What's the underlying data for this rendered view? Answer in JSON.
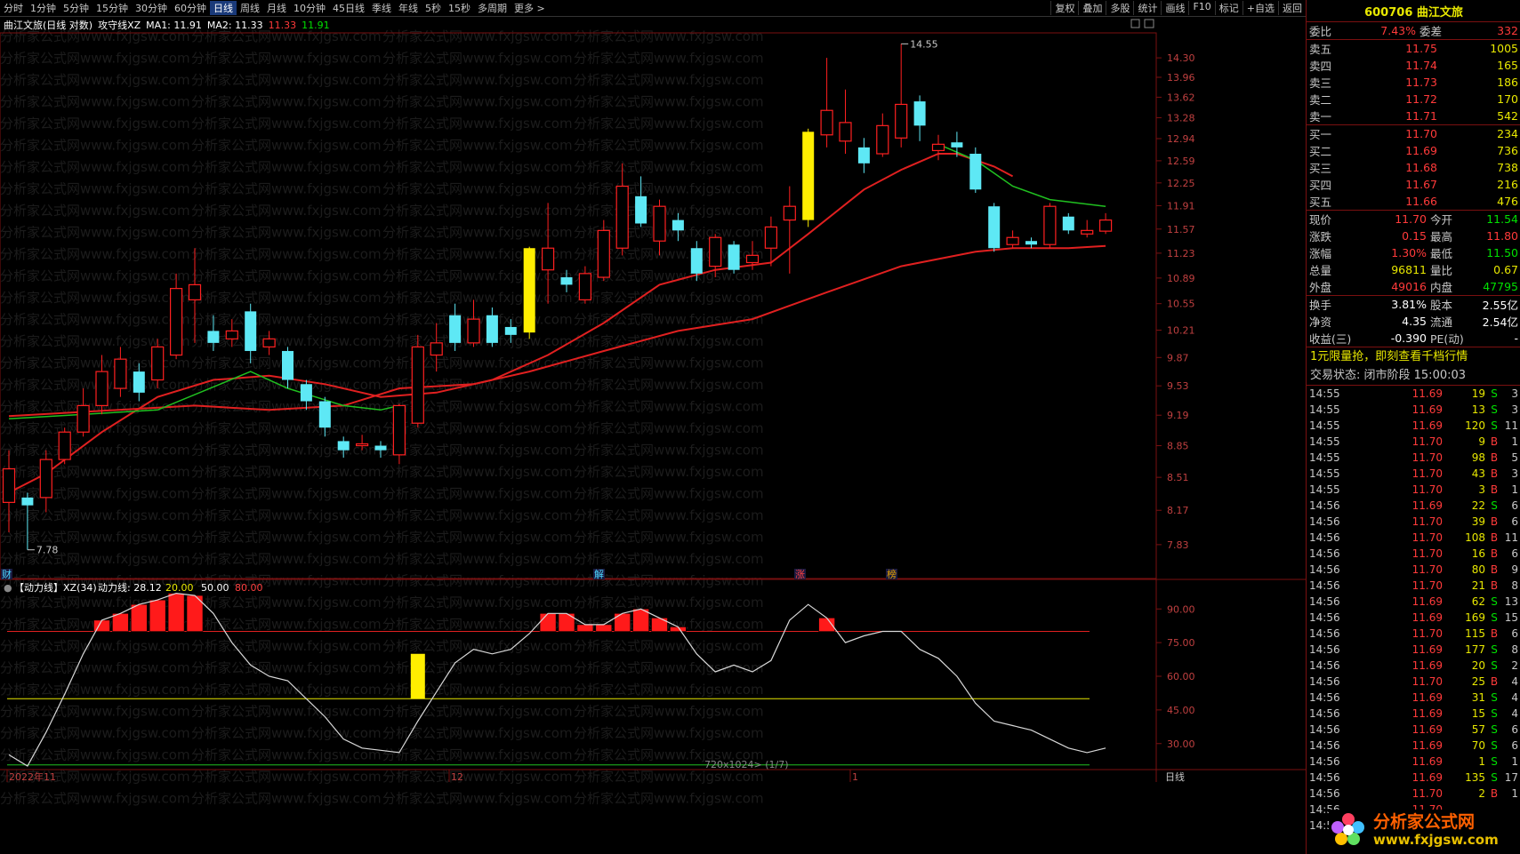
{
  "topbar": {
    "period_tabs": [
      "分时",
      "1分钟",
      "5分钟",
      "15分钟",
      "30分钟",
      "60分钟",
      "日线",
      "周线",
      "月线",
      "10分钟",
      "45日线",
      "季线",
      "年线",
      "5秒",
      "15秒",
      "多周期",
      "更多 >"
    ],
    "active_tab": "日线",
    "tools": [
      "复权",
      "叠加",
      "多股",
      "统计",
      "画线",
      "F10",
      "标记",
      "+自选",
      "返回"
    ]
  },
  "infoline": {
    "stock": "曲江文旅(日线 对数)",
    "indicator": "攻守线XZ",
    "ma1_label": "MA1: 11.91",
    "ma2_label": "MA2: 11.33",
    "v1": "11.33",
    "v2": "11.91"
  },
  "price_axis": [
    "14.30",
    "13.96",
    "13.62",
    "13.28",
    "12.94",
    "12.59",
    "12.25",
    "11.91",
    "11.57",
    "11.23",
    "10.89",
    "10.55",
    "10.21",
    "9.87",
    "9.53",
    "9.19",
    "8.85",
    "8.51",
    "8.17",
    "7.83"
  ],
  "high_label": "14.55",
  "low_label": "7.78",
  "event_marks": [
    "财",
    "解",
    "涨",
    "榜"
  ],
  "sub": {
    "title": "【动力线】XZ(34)",
    "line_label": "动力线: 28.12",
    "v20": "20.00",
    "v50": "50.00",
    "v80": "80.00",
    "axis": [
      "90.00",
      "75.00",
      "60.00",
      "45.00",
      "30.00"
    ]
  },
  "date_axis": [
    "2022年11",
    "12",
    "1"
  ],
  "date_axis_right": "日线",
  "footer_info": "720x1024> (1/7)",
  "watermark": "分析家公式网www.fxjgsw.com",
  "chart_data": {
    "type": "candlestick",
    "title": "曲江文旅(日线 对数)",
    "ylim": [
      7.78,
      14.55
    ],
    "candles": [
      {
        "o": 8.25,
        "c": 8.6,
        "h": 8.8,
        "l": 7.95
      },
      {
        "o": 8.3,
        "c": 8.22,
        "h": 8.35,
        "l": 7.78
      },
      {
        "o": 8.3,
        "c": 8.7,
        "h": 8.8,
        "l": 8.15
      },
      {
        "o": 8.7,
        "c": 9.0,
        "h": 9.05,
        "l": 8.65
      },
      {
        "o": 9.0,
        "c": 9.3,
        "h": 9.5,
        "l": 8.95
      },
      {
        "o": 9.3,
        "c": 9.7,
        "h": 9.9,
        "l": 9.2
      },
      {
        "o": 9.5,
        "c": 9.85,
        "h": 10.0,
        "l": 9.4
      },
      {
        "o": 9.7,
        "c": 9.45,
        "h": 9.8,
        "l": 9.35
      },
      {
        "o": 9.6,
        "c": 10.0,
        "h": 10.1,
        "l": 9.5
      },
      {
        "o": 9.9,
        "c": 10.75,
        "h": 10.95,
        "l": 9.85
      },
      {
        "o": 10.6,
        "c": 10.8,
        "h": 11.3,
        "l": 10.05
      },
      {
        "o": 10.2,
        "c": 10.05,
        "h": 10.4,
        "l": 9.95
      },
      {
        "o": 10.1,
        "c": 10.2,
        "h": 10.35,
        "l": 10.0
      },
      {
        "o": 10.45,
        "c": 9.95,
        "h": 10.55,
        "l": 9.8
      },
      {
        "o": 10.0,
        "c": 10.1,
        "h": 10.2,
        "l": 9.9
      },
      {
        "o": 9.95,
        "c": 9.6,
        "h": 10.0,
        "l": 9.5
      },
      {
        "o": 9.55,
        "c": 9.35,
        "h": 9.6,
        "l": 9.25
      },
      {
        "o": 9.35,
        "c": 9.05,
        "h": 9.4,
        "l": 8.95
      },
      {
        "o": 8.9,
        "c": 8.8,
        "h": 8.95,
        "l": 8.72
      },
      {
        "o": 8.85,
        "c": 8.87,
        "h": 8.97,
        "l": 8.8
      },
      {
        "o": 8.85,
        "c": 8.8,
        "h": 8.9,
        "l": 8.72
      },
      {
        "o": 8.75,
        "c": 9.3,
        "h": 9.32,
        "l": 8.65
      },
      {
        "o": 9.1,
        "c": 10.0,
        "h": 10.15,
        "l": 9.05
      },
      {
        "o": 9.9,
        "c": 10.05,
        "h": 10.3,
        "l": 9.7
      },
      {
        "o": 10.4,
        "c": 10.05,
        "h": 10.55,
        "l": 9.95
      },
      {
        "o": 10.05,
        "c": 10.35,
        "h": 10.6,
        "l": 10.0
      },
      {
        "o": 10.4,
        "c": 10.05,
        "h": 10.5,
        "l": 10.0
      },
      {
        "o": 10.25,
        "c": 10.15,
        "h": 10.35,
        "l": 10.05
      },
      {
        "o": 10.18,
        "c": 11.3,
        "h": 11.32,
        "l": 10.1
      },
      {
        "o": 11.0,
        "c": 11.3,
        "h": 11.95,
        "l": 10.55
      },
      {
        "o": 10.9,
        "c": 10.8,
        "h": 11.0,
        "l": 10.7
      },
      {
        "o": 10.6,
        "c": 10.95,
        "h": 11.05,
        "l": 10.55
      },
      {
        "o": 10.9,
        "c": 11.55,
        "h": 11.7,
        "l": 10.85
      },
      {
        "o": 11.3,
        "c": 12.2,
        "h": 12.55,
        "l": 11.2
      },
      {
        "o": 12.05,
        "c": 11.65,
        "h": 12.35,
        "l": 11.6
      },
      {
        "o": 11.4,
        "c": 11.9,
        "h": 12.0,
        "l": 11.2
      },
      {
        "o": 11.7,
        "c": 11.55,
        "h": 11.8,
        "l": 11.4
      },
      {
        "o": 11.3,
        "c": 10.95,
        "h": 11.4,
        "l": 10.85
      },
      {
        "o": 11.05,
        "c": 11.45,
        "h": 11.5,
        "l": 10.9
      },
      {
        "o": 11.35,
        "c": 11.0,
        "h": 11.4,
        "l": 10.95
      },
      {
        "o": 11.1,
        "c": 11.2,
        "h": 11.4,
        "l": 11.0
      },
      {
        "o": 11.3,
        "c": 11.6,
        "h": 11.75,
        "l": 11.05
      },
      {
        "o": 11.7,
        "c": 11.9,
        "h": 12.2,
        "l": 10.95
      },
      {
        "o": 11.7,
        "c": 13.05,
        "h": 13.1,
        "l": 11.6
      },
      {
        "o": 13.0,
        "c": 13.4,
        "h": 14.3,
        "l": 12.8
      },
      {
        "o": 12.9,
        "c": 13.2,
        "h": 13.75,
        "l": 12.7
      },
      {
        "o": 12.8,
        "c": 12.55,
        "h": 12.95,
        "l": 12.4
      },
      {
        "o": 12.7,
        "c": 13.15,
        "h": 13.35,
        "l": 12.65
      },
      {
        "o": 12.95,
        "c": 13.5,
        "h": 14.55,
        "l": 12.8
      },
      {
        "o": 13.55,
        "c": 13.15,
        "h": 13.65,
        "l": 12.9
      },
      {
        "o": 12.75,
        "c": 12.85,
        "h": 13.0,
        "l": 12.6
      },
      {
        "o": 12.88,
        "c": 12.8,
        "h": 13.05,
        "l": 12.65
      },
      {
        "o": 12.7,
        "c": 12.15,
        "h": 12.8,
        "l": 12.1
      },
      {
        "o": 11.9,
        "c": 11.3,
        "h": 11.95,
        "l": 11.25
      },
      {
        "o": 11.35,
        "c": 11.45,
        "h": 11.55,
        "l": 11.3
      },
      {
        "o": 11.4,
        "c": 11.35,
        "h": 11.45,
        "l": 11.3
      },
      {
        "o": 11.35,
        "c": 11.9,
        "h": 11.95,
        "l": 11.3
      },
      {
        "o": 11.75,
        "c": 11.55,
        "h": 11.8,
        "l": 11.5
      },
      {
        "o": 11.5,
        "c": 11.55,
        "h": 11.7,
        "l": 11.45
      },
      {
        "o": 11.54,
        "c": 11.7,
        "h": 11.8,
        "l": 11.5
      }
    ],
    "highlight_candles": [
      28,
      43
    ],
    "ma1_green": {
      "segments": [
        [
          0,
          9.15
        ],
        [
          8,
          9.25
        ],
        [
          13,
          9.7
        ],
        [
          15,
          9.5
        ],
        [
          18,
          9.3
        ],
        [
          20,
          9.25
        ],
        [
          21,
          9.3
        ]
      ],
      "tail": [
        [
          50,
          12.85
        ],
        [
          52,
          12.6
        ],
        [
          54,
          12.2
        ],
        [
          56,
          12.0
        ],
        [
          59,
          11.9
        ]
      ]
    },
    "ma2_red": [
      [
        0,
        8.35
      ],
      [
        2,
        8.55
      ],
      [
        5,
        9.0
      ],
      [
        8,
        9.4
      ],
      [
        11,
        9.6
      ],
      [
        14,
        9.65
      ],
      [
        17,
        9.55
      ],
      [
        20,
        9.4
      ],
      [
        23,
        9.45
      ],
      [
        26,
        9.6
      ],
      [
        29,
        9.9
      ],
      [
        32,
        10.3
      ],
      [
        35,
        10.8
      ],
      [
        38,
        11.0
      ],
      [
        41,
        11.1
      ],
      [
        43,
        11.5
      ],
      [
        46,
        12.15
      ],
      [
        48,
        12.45
      ],
      [
        50,
        12.7
      ],
      [
        51,
        12.7
      ],
      [
        53,
        12.5
      ],
      [
        54,
        12.35
      ]
    ],
    "ma2_red_low": [
      [
        0,
        9.18
      ],
      [
        10,
        9.3
      ],
      [
        14,
        9.25
      ],
      [
        18,
        9.3
      ],
      [
        21,
        9.5
      ],
      [
        25,
        9.55
      ],
      [
        28,
        9.7
      ],
      [
        32,
        9.95
      ],
      [
        36,
        10.2
      ],
      [
        40,
        10.35
      ],
      [
        44,
        10.7
      ],
      [
        48,
        11.05
      ],
      [
        52,
        11.25
      ],
      [
        54,
        11.3
      ],
      [
        57,
        11.3
      ],
      [
        59,
        11.33
      ]
    ],
    "power_line": [
      25,
      20,
      35,
      52,
      70,
      85,
      88,
      92,
      94,
      97,
      96,
      88,
      75,
      65,
      60,
      58,
      50,
      42,
      32,
      28,
      27,
      26,
      40,
      53,
      66,
      72,
      70,
      72,
      79,
      88,
      88,
      83,
      83,
      88,
      90,
      86,
      82,
      70,
      62,
      65,
      62,
      67,
      85,
      92,
      86,
      75,
      78,
      80,
      80,
      72,
      68,
      60,
      48,
      40,
      38,
      36,
      32,
      28,
      26,
      28
    ],
    "power_bars_red": [
      4,
      5,
      6,
      7,
      8,
      9,
      10,
      28,
      29,
      30,
      31,
      32,
      33,
      34,
      35,
      36,
      37,
      44,
      45,
      46,
      47,
      49
    ],
    "power_bar_yellow": 22
  },
  "quote": {
    "code_name": "600706 曲江文旅",
    "weibi": {
      "label": "委比",
      "value": "7.43%",
      "label2": "委差",
      "value2": "332"
    },
    "asks": [
      {
        "label": "卖五",
        "price": "11.75",
        "vol": "1005"
      },
      {
        "label": "卖四",
        "price": "11.74",
        "vol": "165"
      },
      {
        "label": "卖三",
        "price": "11.73",
        "vol": "186"
      },
      {
        "label": "卖二",
        "price": "11.72",
        "vol": "170"
      },
      {
        "label": "卖一",
        "price": "11.71",
        "vol": "542"
      }
    ],
    "bids": [
      {
        "label": "买一",
        "price": "11.70",
        "vol": "234"
      },
      {
        "label": "买二",
        "price": "11.69",
        "vol": "736"
      },
      {
        "label": "买三",
        "price": "11.68",
        "vol": "738"
      },
      {
        "label": "买四",
        "price": "11.67",
        "vol": "216"
      },
      {
        "label": "买五",
        "price": "11.66",
        "vol": "476"
      }
    ],
    "stats": [
      {
        "k": "现价",
        "v": "11.70",
        "k2": "今开",
        "v2": "11.54",
        "vc": "red",
        "v2c": "green"
      },
      {
        "k": "涨跌",
        "v": "0.15",
        "k2": "最高",
        "v2": "11.80",
        "vc": "red",
        "v2c": "red"
      },
      {
        "k": "涨幅",
        "v": "1.30%",
        "k2": "最低",
        "v2": "11.50",
        "vc": "red",
        "v2c": "green"
      },
      {
        "k": "总量",
        "v": "96811",
        "k2": "量比",
        "v2": "0.67",
        "vc": "yellow",
        "v2c": "yellow"
      },
      {
        "k": "外盘",
        "v": "49016",
        "k2": "内盘",
        "v2": "47795",
        "vc": "red",
        "v2c": "green"
      }
    ],
    "stats2": [
      {
        "k": "换手",
        "v": "3.81%",
        "k2": "股本",
        "v2": "2.55亿"
      },
      {
        "k": "净资",
        "v": "4.35",
        "k2": "流通",
        "v2": "2.54亿"
      },
      {
        "k": "收益(三)",
        "v": "-0.390",
        "k2": "PE(动)",
        "v2": "-"
      }
    ],
    "promo": "1元限量抢，即刻查看千档行情",
    "status": "交易状态: 闭市阶段 15:00:03",
    "ticks": [
      {
        "t": "14:55",
        "p": "11.69",
        "v": "19",
        "bs": "S",
        "n": "3"
      },
      {
        "t": "14:55",
        "p": "11.69",
        "v": "13",
        "bs": "S",
        "n": "3"
      },
      {
        "t": "14:55",
        "p": "11.69",
        "v": "120",
        "bs": "S",
        "n": "11"
      },
      {
        "t": "14:55",
        "p": "11.70",
        "v": "9",
        "bs": "B",
        "n": "1"
      },
      {
        "t": "14:55",
        "p": "11.70",
        "v": "98",
        "bs": "B",
        "n": "5"
      },
      {
        "t": "14:55",
        "p": "11.70",
        "v": "43",
        "bs": "B",
        "n": "3"
      },
      {
        "t": "14:55",
        "p": "11.70",
        "v": "3",
        "bs": "B",
        "n": "1"
      },
      {
        "t": "14:56",
        "p": "11.69",
        "v": "22",
        "bs": "S",
        "n": "6"
      },
      {
        "t": "14:56",
        "p": "11.70",
        "v": "39",
        "bs": "B",
        "n": "6"
      },
      {
        "t": "14:56",
        "p": "11.70",
        "v": "108",
        "bs": "B",
        "n": "11"
      },
      {
        "t": "14:56",
        "p": "11.70",
        "v": "16",
        "bs": "B",
        "n": "6"
      },
      {
        "t": "14:56",
        "p": "11.70",
        "v": "80",
        "bs": "B",
        "n": "9"
      },
      {
        "t": "14:56",
        "p": "11.70",
        "v": "21",
        "bs": "B",
        "n": "8"
      },
      {
        "t": "14:56",
        "p": "11.69",
        "v": "62",
        "bs": "S",
        "n": "13"
      },
      {
        "t": "14:56",
        "p": "11.69",
        "v": "169",
        "bs": "S",
        "n": "15"
      },
      {
        "t": "14:56",
        "p": "11.70",
        "v": "115",
        "bs": "B",
        "n": "6"
      },
      {
        "t": "14:56",
        "p": "11.69",
        "v": "177",
        "bs": "S",
        "n": "8"
      },
      {
        "t": "14:56",
        "p": "11.69",
        "v": "20",
        "bs": "S",
        "n": "2"
      },
      {
        "t": "14:56",
        "p": "11.70",
        "v": "25",
        "bs": "B",
        "n": "4"
      },
      {
        "t": "14:56",
        "p": "11.69",
        "v": "31",
        "bs": "S",
        "n": "4"
      },
      {
        "t": "14:56",
        "p": "11.69",
        "v": "15",
        "bs": "S",
        "n": "4"
      },
      {
        "t": "14:56",
        "p": "11.69",
        "v": "57",
        "bs": "S",
        "n": "6"
      },
      {
        "t": "14:56",
        "p": "11.69",
        "v": "70",
        "bs": "S",
        "n": "6"
      },
      {
        "t": "14:56",
        "p": "11.69",
        "v": "1",
        "bs": "S",
        "n": "1"
      },
      {
        "t": "14:56",
        "p": "11.69",
        "v": "135",
        "bs": "S",
        "n": "17"
      },
      {
        "t": "14:56",
        "p": "11.70",
        "v": "2",
        "bs": "B",
        "n": "1"
      },
      {
        "t": "14:56",
        "p": "11.70",
        "v": "",
        "bs": "",
        "n": ""
      },
      {
        "t": "14:56",
        "p": "",
        "v": "",
        "bs": "",
        "n": ""
      }
    ]
  },
  "logo": {
    "cn": "分析家公式网",
    "url": "www.fxjgsw.com"
  },
  "colors": {
    "up": "#ff2020",
    "down": "#5ee8f5",
    "highlight": "#ffee00",
    "ma_green": "#20c020",
    "ma_red": "#e02020",
    "grid_red": "#7a1010"
  }
}
